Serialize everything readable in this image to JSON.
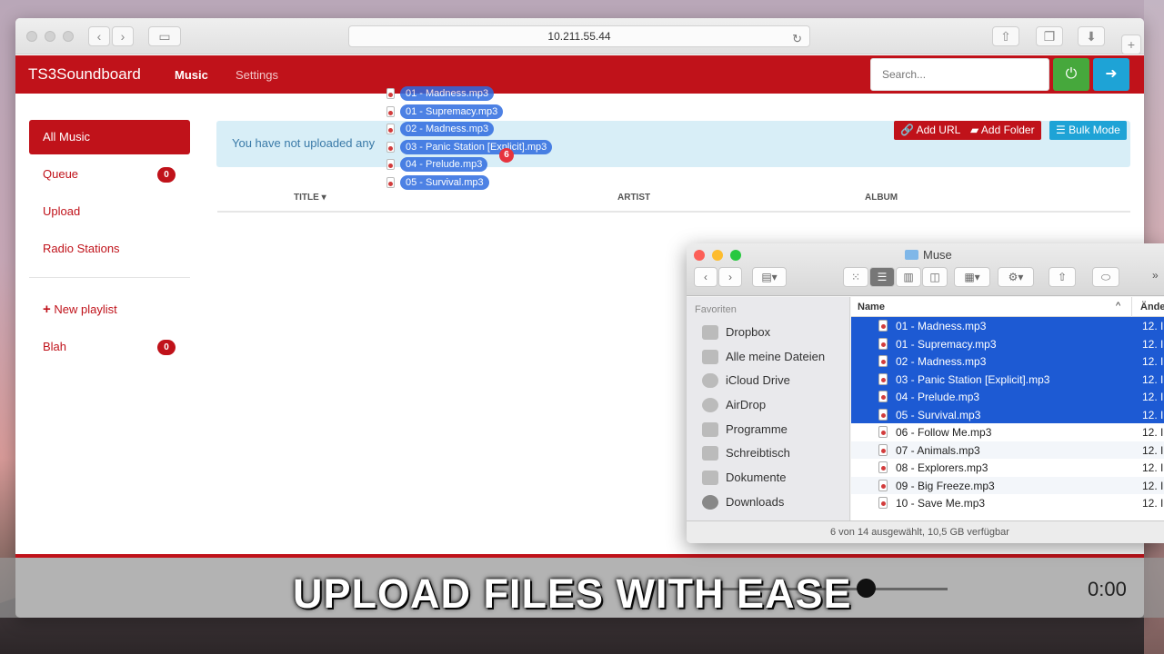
{
  "browser": {
    "address": "10.211.55.44"
  },
  "app": {
    "brand": "TS3Soundboard",
    "nav": {
      "music": "Music",
      "settings": "Settings"
    },
    "search_placeholder": "Search...",
    "sidebar": {
      "items": [
        {
          "label": "All Music",
          "active": true
        },
        {
          "label": "Queue",
          "badge": "0"
        },
        {
          "label": "Upload"
        },
        {
          "label": "Radio Stations"
        }
      ],
      "new_playlist": "New playlist",
      "playlists": [
        {
          "label": "Blah",
          "badge": "0"
        }
      ]
    },
    "alert_text": "You have not uploaded any",
    "buttons": {
      "add_url": "Add URL",
      "add_folder": "Add Folder",
      "bulk_mode": "Bulk Mode"
    },
    "table_headers": {
      "title": "TITLE",
      "artist": "ARTIST",
      "album": "ALBUM"
    }
  },
  "drag": {
    "items": [
      "01 - Madness.mp3",
      "01 - Supremacy.mp3",
      "02 - Madness.mp3",
      "03 - Panic Station [Explicit].mp3",
      "04 - Prelude.mp3",
      "05 - Survival.mp3"
    ],
    "count": "6"
  },
  "finder": {
    "title": "Muse",
    "favorites_label": "Favoriten",
    "sidebar": [
      "Dropbox",
      "Alle meine Dateien",
      "iCloud Drive",
      "AirDrop",
      "Programme",
      "Schreibtisch",
      "Dokumente",
      "Downloads"
    ],
    "columns": {
      "name": "Name",
      "date": "Ände"
    },
    "files": [
      {
        "name": "01 - Madness.mp3",
        "date": "12. I",
        "selected": true
      },
      {
        "name": "01 - Supremacy.mp3",
        "date": "12. I",
        "selected": true
      },
      {
        "name": "02 - Madness.mp3",
        "date": "12. I",
        "selected": true
      },
      {
        "name": "03 - Panic Station [Explicit].mp3",
        "date": "12. I",
        "selected": true
      },
      {
        "name": "04 - Prelude.mp3",
        "date": "12. I",
        "selected": true
      },
      {
        "name": "05 - Survival.mp3",
        "date": "12. I",
        "selected": true
      },
      {
        "name": "06 - Follow Me.mp3",
        "date": "12. I",
        "selected": false
      },
      {
        "name": "07 - Animals.mp3",
        "date": "12. I",
        "selected": false
      },
      {
        "name": "08 - Explorers.mp3",
        "date": "12. I",
        "selected": false
      },
      {
        "name": "09 - Big Freeze.mp3",
        "date": "12. I",
        "selected": false
      },
      {
        "name": "10 - Save Me.mp3",
        "date": "12. I",
        "selected": false
      }
    ],
    "status": "6 von 14 ausgewählt, 10,5 GB verfügbar"
  },
  "player": {
    "time": "0:00"
  },
  "caption": "UPLOAD FILES WITH EASE",
  "colors": {
    "brand_red": "#c0121a",
    "power_green": "#46a83c",
    "logout_blue": "#1ea3d6",
    "selection_blue": "#1d5ad3"
  }
}
